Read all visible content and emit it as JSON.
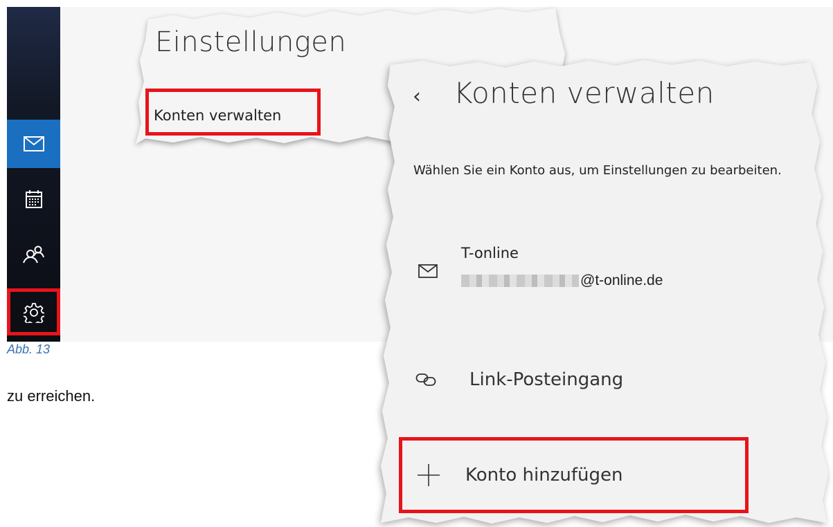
{
  "settings_panel": {
    "title": "Einstellungen",
    "manage_accounts_link": "Konten verwalten"
  },
  "nav_rail": {
    "items": [
      {
        "icon": "mail-icon",
        "active": true
      },
      {
        "icon": "calendar-icon",
        "active": false
      },
      {
        "icon": "people-icon",
        "active": false
      },
      {
        "icon": "gear-icon",
        "active": false
      }
    ]
  },
  "figure": {
    "caption": "Abb. 13"
  },
  "document": {
    "text": "zu erreichen."
  },
  "manage_accounts": {
    "back_glyph": "‹",
    "title": "Konten verwalten",
    "description": "Wählen Sie ein Konto aus, um Einstellungen zu bearbeiten.",
    "account": {
      "name": "T-online",
      "email_domain": "@t-online.de",
      "icon": "mail-icon"
    },
    "linked_inbox": {
      "label": "Link-Posteingang",
      "icon": "link-icon"
    },
    "add_account": {
      "label": "Konto hinzufügen",
      "icon": "plus-icon"
    }
  },
  "colors": {
    "highlight": "#e8141b",
    "accent": "#1a6fc0",
    "caption": "#3a73b4"
  }
}
